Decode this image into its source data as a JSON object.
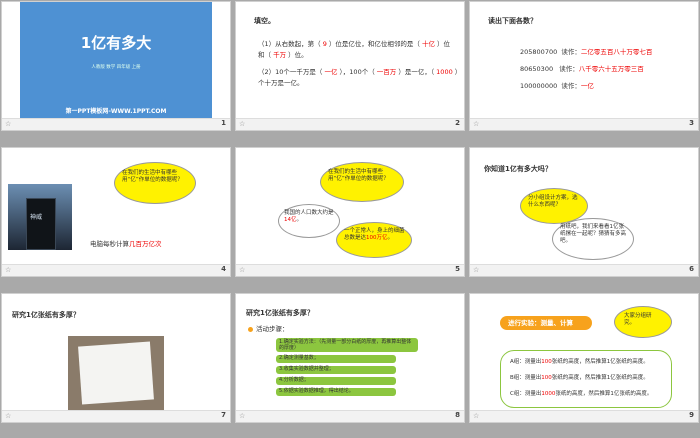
{
  "slides": [
    {
      "num": "1",
      "title": "1亿有多大",
      "subtitle": "人教版 数学 四年级 上册",
      "footer": "第一PPT模板网-WWW.1PPT.COM"
    },
    {
      "num": "2",
      "heading": "填空。",
      "l1a": "（1）从右数起，第（ ",
      "l1b": "9",
      "l1c": " ）位是亿位，和亿位相邻的是（ ",
      "l1d": "十亿",
      "l1e": " ）位",
      "l2a": "和（ ",
      "l2b": "千万",
      "l2c": " ）位。",
      "l3a": "（2）10个一千万是（ ",
      "l3b": "一亿",
      "l3c": " ），100个（ ",
      "l3d": "一百万",
      "l3e": " ）是一亿，（ ",
      "l3f": "1000",
      "l3g": " ）",
      "l4": "个十万是一亿。"
    },
    {
      "num": "3",
      "heading": "读出下面各数？",
      "rows": [
        {
          "n": "205800700",
          "k": "读作：",
          "v": "二亿零五百八十万零七百"
        },
        {
          "n": "80650300",
          "k": "读作：",
          "v": "八千零六十五万零三百"
        },
        {
          "n": "100000000",
          "k": "读作：",
          "v": "一亿"
        }
      ]
    },
    {
      "num": "4",
      "bubble": "在我们的生活中有哪些用“亿”作单位的数据呢？",
      "cap1": "电脑每秒计算",
      "cap2": "几百万亿次",
      "screen": "神威"
    },
    {
      "num": "5",
      "b1": "在我们的生活中有哪些用“亿”作单位的数据呢？",
      "b2a": "我国的人口数大约是",
      "b2b": "14亿",
      "b2c": "。",
      "b3a": "一个正常人，身上的细菌总数是达",
      "b3b": "100万亿",
      "b3c": "。"
    },
    {
      "num": "6",
      "heading": "你知道1亿有多大吗？",
      "b1": "分小组设计方案，选什么东西呢？",
      "b2": "用纸吧，我们来看看1亿张纸摞在一起呢？猜猜有多高吧。"
    },
    {
      "num": "7",
      "heading": "研究1亿张纸有多厚？"
    },
    {
      "num": "8",
      "heading": "研究1亿张纸有多厚？",
      "label": "活动步骤：",
      "steps": [
        "1.确定实验方法：（先测量一部分白纸的厚度，再推算出整体的厚度）",
        "2.确定测量基数；",
        "3.收集实验数据并整理；",
        "4.分析数据；",
        "5.依据实验数据推理，得出结论。"
      ]
    },
    {
      "num": "9",
      "tag": "进行实验：测量、计算",
      "bubble": "大家分组研究。",
      "rows": [
        {
          "p": "A组：测量出",
          "v": "100",
          "s": "张纸的高度，然后推算1亿张纸的高度。"
        },
        {
          "p": "B组：测量出",
          "v": "100",
          "s": "张纸的高度，然后推算1亿张纸的高度。"
        },
        {
          "p": "C组：测量出",
          "v": "1000",
          "s": "张纸的高度，然后推算1亿张纸的高度。"
        }
      ]
    }
  ],
  "colors": {
    "title_blue": "#4e91d3",
    "red": "#e00000",
    "green": "#8cc63f",
    "orange": "#f7a21c",
    "yellow": "#fff200"
  }
}
